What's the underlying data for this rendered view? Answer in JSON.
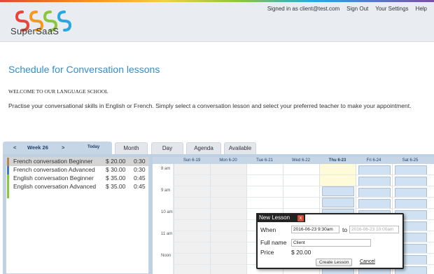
{
  "brand": {
    "name": "SuperSaaS",
    "logo_colors": [
      "#e8463a",
      "#f39a1c",
      "#8cc63f",
      "#2aa7e0"
    ]
  },
  "toplinks": {
    "signed_in": "Signed in as client@test.com",
    "sign_out": "Sign Out",
    "settings": "Your Settings",
    "help": "Help"
  },
  "page": {
    "title": "Schedule for Conversation lessons",
    "welcome": "WELCOME TO OUR LANGUAGE SCHOOL",
    "intro": "Practise your conversational skills in English or French. Simply select a conversation lesson and select your preferred teacher to make your appointment."
  },
  "nav": {
    "prev": "<",
    "week": "Week 26",
    "next": ">",
    "today": "Today",
    "tabs": [
      "Month",
      "Day",
      "Agenda",
      "Available"
    ]
  },
  "services": [
    {
      "name": "French conversation Beginner",
      "price": "$ 20.00",
      "duration": "0:30",
      "color": "#b0855a",
      "selected": true
    },
    {
      "name": "French conversation Advanced",
      "price": "$ 30.00",
      "duration": "0:30",
      "color": "#3f7cc7",
      "selected": false
    },
    {
      "name": "English conversation Beginner",
      "price": "$ 35.00",
      "duration": "0:45",
      "color": "#8cc63f",
      "selected": false
    },
    {
      "name": "English conversation Advanced",
      "price": "$ 35.00",
      "duration": "0:45",
      "color": "#8cc63f",
      "selected": false
    }
  ],
  "calendar": {
    "days": [
      "Sun 6-19",
      "Mon 6-20",
      "Tue 6-21",
      "Wed 6-22",
      "Thu 6-23",
      "Fri 6-24",
      "Sat 6-25"
    ],
    "current_day": "Thu 6-23",
    "times": [
      "8 am",
      "9 am",
      "10 am",
      "11 am",
      "Noon"
    ],
    "colors": {
      "past": "#f0f0f0",
      "today": "#fffbd9",
      "slot": "#cfe1f2"
    }
  },
  "popup": {
    "title": "New Lesson",
    "close": "x",
    "when_label": "When",
    "start": "2016-06-23 9:30am",
    "to_label": "to",
    "end": "2016-06-23 10:00am",
    "name_label": "Full name",
    "name_value": "Client",
    "price_label": "Price",
    "price_value": "$ 20.00",
    "create": "Create Lesson",
    "cancel": "Cancel"
  }
}
